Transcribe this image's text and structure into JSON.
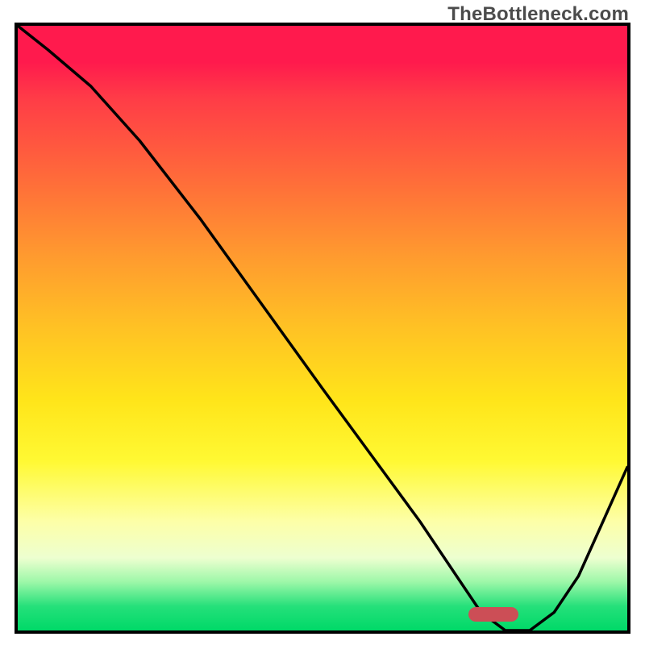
{
  "watermark": "TheBottleneck.com",
  "marker": {
    "x_pct": 78,
    "y_pct": 97.3
  },
  "chart_data": {
    "type": "line",
    "title": "",
    "xlabel": "",
    "ylabel": "",
    "xlim": [
      0,
      100
    ],
    "ylim": [
      0,
      100
    ],
    "x": [
      0,
      5,
      12,
      20,
      30,
      40,
      50,
      58,
      66,
      72,
      76,
      80,
      84,
      88,
      92,
      96,
      100
    ],
    "values": [
      100,
      96,
      90,
      81,
      68,
      54,
      40,
      29,
      18,
      9,
      3,
      0,
      0,
      3,
      9,
      18,
      27
    ],
    "annotations": [
      {
        "type": "marker",
        "shape": "rounded-bar",
        "x": 78,
        "y": 0,
        "color": "#cc4e56"
      }
    ],
    "background_gradient_stops": [
      {
        "pct": 0,
        "color": "#ff1a4d"
      },
      {
        "pct": 25,
        "color": "#ff6a3a"
      },
      {
        "pct": 50,
        "color": "#ffc224"
      },
      {
        "pct": 72,
        "color": "#fff933"
      },
      {
        "pct": 88,
        "color": "#edffd0"
      },
      {
        "pct": 100,
        "color": "#00d968"
      }
    ]
  }
}
